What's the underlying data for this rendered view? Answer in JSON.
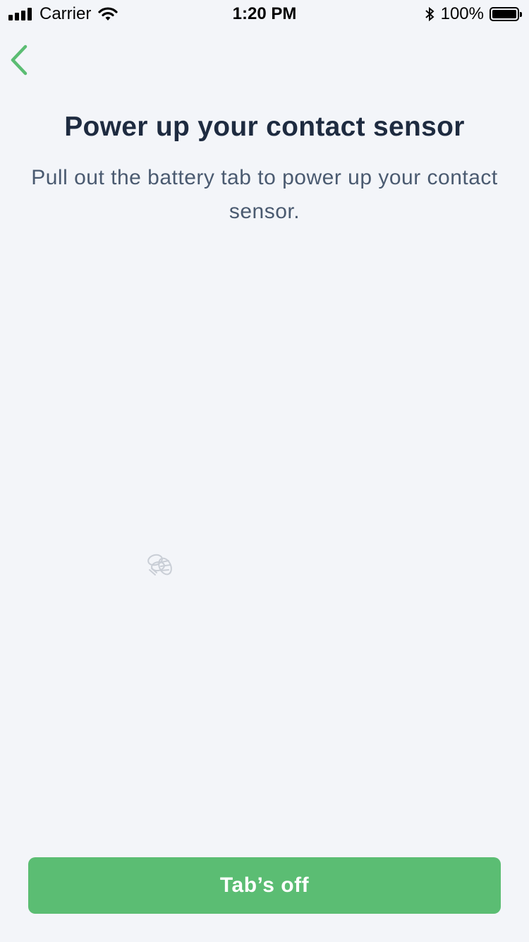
{
  "status_bar": {
    "carrier": "Carrier",
    "time": "1:20 PM",
    "battery_text": "100%",
    "battery_level": 1.0,
    "icons": [
      "signal-icon",
      "wifi-icon",
      "bluetooth-icon",
      "battery-icon"
    ]
  },
  "nav": {
    "back_icon": "chevron-left-icon",
    "accent_color": "#5bbd73"
  },
  "content": {
    "title": "Power up your contact sensor",
    "subtitle": "Pull out the battery tab to power up your contact sensor.",
    "loader_icon": "bee-icon"
  },
  "footer": {
    "primary_label": "Tab’s off",
    "primary_color": "#5bbd73"
  }
}
